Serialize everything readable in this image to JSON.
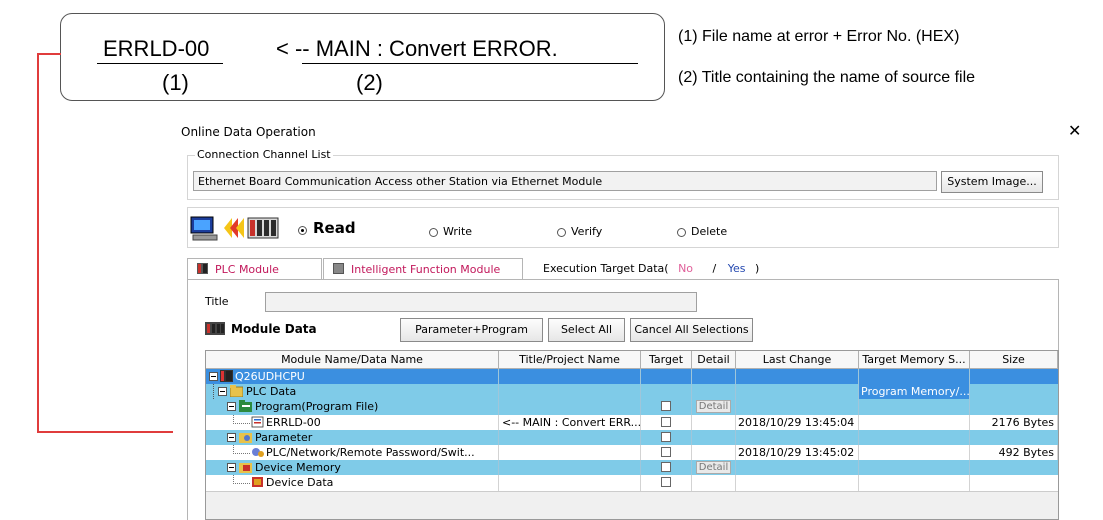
{
  "annotation": {
    "code": "ERRLD-00",
    "title": "< -- MAIN : Convert ERROR.",
    "label1": "(1)",
    "label2": "(2)",
    "note1": "(1) File name at error + Error No. (HEX)",
    "note2": "(2) Title containing the name of source file",
    "connector_color": "#e03c3c"
  },
  "dialog": {
    "title": "Online Data Operation",
    "close_icon": "close-icon",
    "connection": {
      "legend": "Connection Channel List",
      "value": "Ethernet Board Communication  Access other Station via Ethernet Module",
      "system_image_button": "System Image..."
    },
    "operations": [
      {
        "label": "Read",
        "selected": true
      },
      {
        "label": "Write",
        "selected": false
      },
      {
        "label": "Verify",
        "selected": false
      },
      {
        "label": "Delete",
        "selected": false
      }
    ],
    "tabs": [
      {
        "label": "PLC Module",
        "active": true
      },
      {
        "label": "Intelligent Function Module",
        "active": false
      }
    ],
    "execution_target": {
      "prefix": "Execution Target Data(",
      "no": "No",
      "sep": "/",
      "yes": "Yes",
      "suffix": ")",
      "no_color": "#e0609a",
      "yes_color": "#2448b0"
    },
    "title_label": "Title",
    "title_value": "",
    "module_data_label": "Module Data",
    "buttons": {
      "parameter_program": "Parameter+Program",
      "select_all": "Select All",
      "cancel_all": "Cancel All Selections"
    },
    "table": {
      "columns": [
        "Module Name/Data Name",
        "Title/Project Name",
        "Target",
        "Detail",
        "Last Change",
        "Target Memory S...",
        "Size"
      ],
      "rows": [
        {
          "name": "Q26UDHCPU",
          "title": "",
          "target": false,
          "detail": "",
          "last_change": "",
          "memory": "",
          "size": ""
        },
        {
          "name": "PLC Data",
          "title": "",
          "target": false,
          "detail": "",
          "last_change": "",
          "memory": "Program Memory/...",
          "size": ""
        },
        {
          "name": "Program(Program File)",
          "title": "",
          "target": true,
          "detail": "Detail",
          "last_change": "",
          "memory": "",
          "size": ""
        },
        {
          "name": "ERRLD-00",
          "title": "<-- MAIN : Convert ERR...",
          "target": true,
          "detail": "",
          "last_change": "2018/10/29 13:45:04",
          "memory": "",
          "size": "2176 Bytes"
        },
        {
          "name": "Parameter",
          "title": "",
          "target": true,
          "detail": "",
          "last_change": "",
          "memory": "",
          "size": ""
        },
        {
          "name": "PLC/Network/Remote Password/Swit...",
          "title": "",
          "target": true,
          "detail": "",
          "last_change": "2018/10/29 13:45:02",
          "memory": "",
          "size": "492 Bytes"
        },
        {
          "name": "Device Memory",
          "title": "",
          "target": true,
          "detail": "Detail",
          "last_change": "",
          "memory": "",
          "size": ""
        },
        {
          "name": "Device Data",
          "title": "",
          "target": true,
          "detail": "",
          "last_change": "",
          "memory": "",
          "size": ""
        }
      ]
    }
  }
}
